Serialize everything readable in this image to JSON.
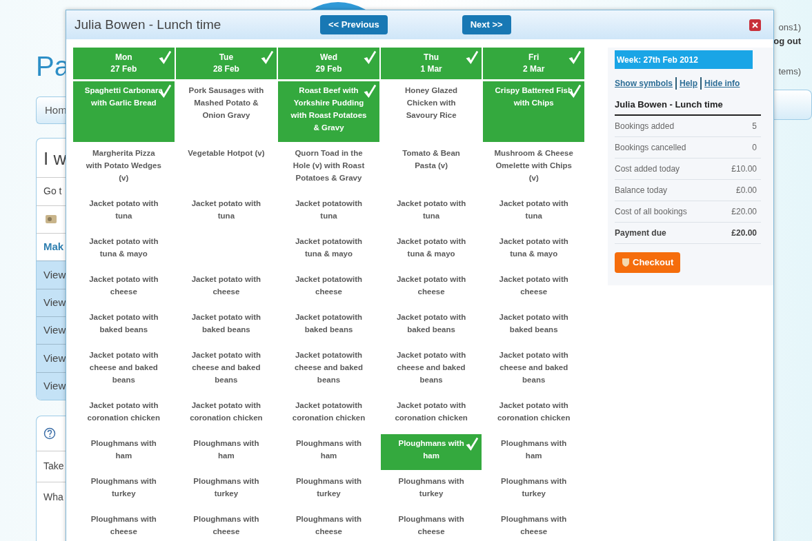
{
  "background": {
    "heading": "Pa",
    "nav_tab": "Hom",
    "panel": {
      "title": "I w",
      "items": [
        {
          "kind": "plain",
          "text": "Go t"
        },
        {
          "kind": "icon"
        },
        {
          "kind": "active",
          "text": "Mak"
        },
        {
          "kind": "link",
          "text": "View"
        },
        {
          "kind": "link",
          "text": "View"
        },
        {
          "kind": "link",
          "text": "View"
        },
        {
          "kind": "link",
          "text": "View"
        },
        {
          "kind": "link",
          "text": "View"
        }
      ]
    },
    "help_panel": {
      "items": [
        "Take",
        "Wha"
      ]
    },
    "right_texts": [
      "ons1)",
      "og out",
      "tems)"
    ]
  },
  "dialog": {
    "title": "Julia Bowen - Lunch time",
    "prev_button": "<< Previous",
    "next_button": "Next >>",
    "days": [
      {
        "day": "Mon",
        "date": "27 Feb",
        "selected": true
      },
      {
        "day": "Tue",
        "date": "28 Feb",
        "selected": true
      },
      {
        "day": "Wed",
        "date": "29 Feb",
        "selected": true
      },
      {
        "day": "Thu",
        "date": "1 Mar",
        "selected": true
      },
      {
        "day": "Fri",
        "date": "2 Mar",
        "selected": true
      }
    ],
    "rows": [
      {
        "cells": [
          {
            "text": "Spaghetti Carbonara with Garlic Bread",
            "selected": true
          },
          {
            "text": "Pork Sausages with Mashed Potato & Onion Gravy",
            "selected": false
          },
          {
            "text": "Roast Beef with Yorkshire Pudding with Roast Potatoes & Gravy",
            "selected": true
          },
          {
            "text": "Honey Glazed Chicken with Savoury Rice",
            "selected": false
          },
          {
            "text": "Crispy Battered Fish with Chips",
            "selected": true
          }
        ]
      },
      {
        "cells": [
          {
            "text": "Margherita Pizza with Potato Wedges (v)",
            "selected": false
          },
          {
            "text": "Vegetable Hotpot (v)",
            "selected": false
          },
          {
            "text": "Quorn Toad in the Hole (v) with Roast Potatoes & Gravy",
            "selected": false
          },
          {
            "text": "Tomato & Bean Pasta (v)",
            "selected": false
          },
          {
            "text": "Mushroom & Cheese Omelette with Chips (v)",
            "selected": false
          }
        ]
      },
      {
        "cells": [
          {
            "text": "Jacket potato with tuna",
            "selected": false
          },
          {
            "text": "Jacket potato with tuna",
            "selected": false
          },
          {
            "text": "Jacket potatowith tuna",
            "selected": false
          },
          {
            "text": "Jacket potato with tuna",
            "selected": false
          },
          {
            "text": "Jacket potato with tuna",
            "selected": false
          }
        ]
      },
      {
        "cells": [
          {
            "text": "Jacket potato with tuna & mayo",
            "selected": false
          },
          null,
          {
            "text": "Jacket potatowith tuna & mayo",
            "selected": false
          },
          {
            "text": "Jacket potato with tuna & mayo",
            "selected": false
          },
          {
            "text": "Jacket potato with tuna & mayo",
            "selected": false
          }
        ]
      },
      {
        "cells": [
          {
            "text": "Jacket potato with cheese",
            "selected": false
          },
          {
            "text": "Jacket potato with cheese",
            "selected": false
          },
          {
            "text": "Jacket potatowith cheese",
            "selected": false
          },
          {
            "text": "Jacket potato with cheese",
            "selected": false
          },
          {
            "text": "Jacket potato with cheese",
            "selected": false
          }
        ]
      },
      {
        "cells": [
          {
            "text": "Jacket potato with baked beans",
            "selected": false
          },
          {
            "text": "Jacket potato with baked beans",
            "selected": false
          },
          {
            "text": "Jacket potatowith baked beans",
            "selected": false
          },
          {
            "text": "Jacket potato with baked beans",
            "selected": false
          },
          {
            "text": "Jacket potato with baked beans",
            "selected": false
          }
        ]
      },
      {
        "cells": [
          {
            "text": "Jacket potato with cheese and baked beans",
            "selected": false
          },
          {
            "text": "Jacket potato with cheese and baked beans",
            "selected": false
          },
          {
            "text": "Jacket potatowith cheese and baked beans",
            "selected": false
          },
          {
            "text": "Jacket potato with cheese and baked beans",
            "selected": false
          },
          {
            "text": "Jacket potato with cheese and baked beans",
            "selected": false
          }
        ]
      },
      {
        "cells": [
          {
            "text": "Jacket potato with coronation chicken",
            "selected": false
          },
          {
            "text": "Jacket potato with coronation chicken",
            "selected": false
          },
          {
            "text": "Jacket potatowith coronation chicken",
            "selected": false
          },
          {
            "text": "Jacket potato with coronation chicken",
            "selected": false
          },
          {
            "text": "Jacket potato with coronation chicken",
            "selected": false
          }
        ]
      },
      {
        "cells": [
          {
            "text": "Ploughmans with ham",
            "selected": false
          },
          {
            "text": "Ploughmans with ham",
            "selected": false
          },
          {
            "text": "Ploughmans with ham",
            "selected": false
          },
          {
            "text": "Ploughmans with ham",
            "selected": true
          },
          {
            "text": "Ploughmans with ham",
            "selected": false
          }
        ]
      },
      {
        "cells": [
          {
            "text": "Ploughmans with turkey",
            "selected": false
          },
          {
            "text": "Ploughmans with turkey",
            "selected": false
          },
          {
            "text": "Ploughmans with turkey",
            "selected": false
          },
          {
            "text": "Ploughmans with turkey",
            "selected": false
          },
          {
            "text": "Ploughmans with turkey",
            "selected": false
          }
        ]
      },
      {
        "cells": [
          {
            "text": "Ploughmans with cheese",
            "selected": false
          },
          {
            "text": "Ploughmans with cheese",
            "selected": false
          },
          {
            "text": "Ploughmans with cheese",
            "selected": false
          },
          {
            "text": "Ploughmans with cheese",
            "selected": false
          },
          {
            "text": "Ploughmans with cheese",
            "selected": false
          }
        ]
      }
    ],
    "info": {
      "week": "Week: 27th Feb 2012",
      "links": [
        "Show symbols",
        "Help",
        "Hide info"
      ],
      "title": "Julia Bowen - Lunch time",
      "stats": [
        {
          "label": "Bookings added",
          "value": "5",
          "bold": false
        },
        {
          "label": "Bookings cancelled",
          "value": "0",
          "bold": false
        },
        {
          "label": "Cost added today",
          "value": "£10.00",
          "bold": false
        },
        {
          "label": "Balance today",
          "value": "£0.00",
          "bold": false
        },
        {
          "label": "Cost of all bookings",
          "value": "£20.00",
          "bold": false
        },
        {
          "label": "Payment due",
          "value": "£20.00",
          "bold": true
        }
      ],
      "checkout": "Checkout"
    }
  }
}
